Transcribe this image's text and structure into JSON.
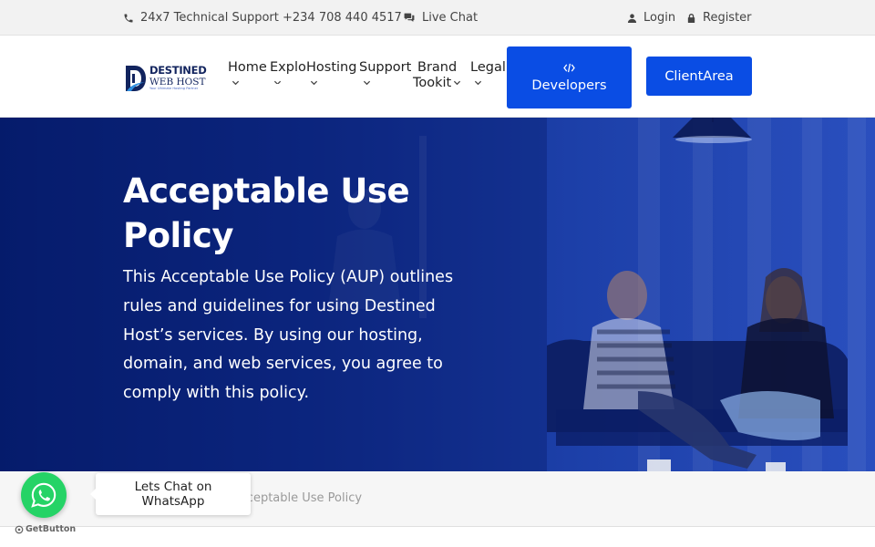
{
  "topbar": {
    "support": "24x7 Technical Support +234 708 440 4517",
    "live_chat": "Live Chat",
    "login": "Login",
    "register": "Register"
  },
  "logo": {
    "line1": "DESTINED",
    "line2": "WEB HOST",
    "tagline": "Your Ultimate Hosting Partner"
  },
  "nav": {
    "home": "Home",
    "explore": "Explore",
    "hosting": "Hosting",
    "support": "Support",
    "brand_line1": "Brand",
    "brand_line2": "Tookit",
    "legal": "Legal",
    "developers": "Developers",
    "client_area": "ClientArea"
  },
  "hero": {
    "title": "Acceptable Use Policy",
    "description": "This Acceptable Use Policy (AUP) outlines rules and guidelines for using Destined Host’s services. By using our hosting, domain, and web services, you agree to comply with this policy."
  },
  "breadcrumb": {
    "current": "Acceptable Use Policy"
  },
  "whatsapp": {
    "label": "Lets Chat on WhatsApp",
    "powered_by": "GetButton"
  },
  "colors": {
    "brand_blue": "#0a4de4",
    "hero_dark": "#061d6e",
    "whatsapp_green": "#25d366"
  }
}
